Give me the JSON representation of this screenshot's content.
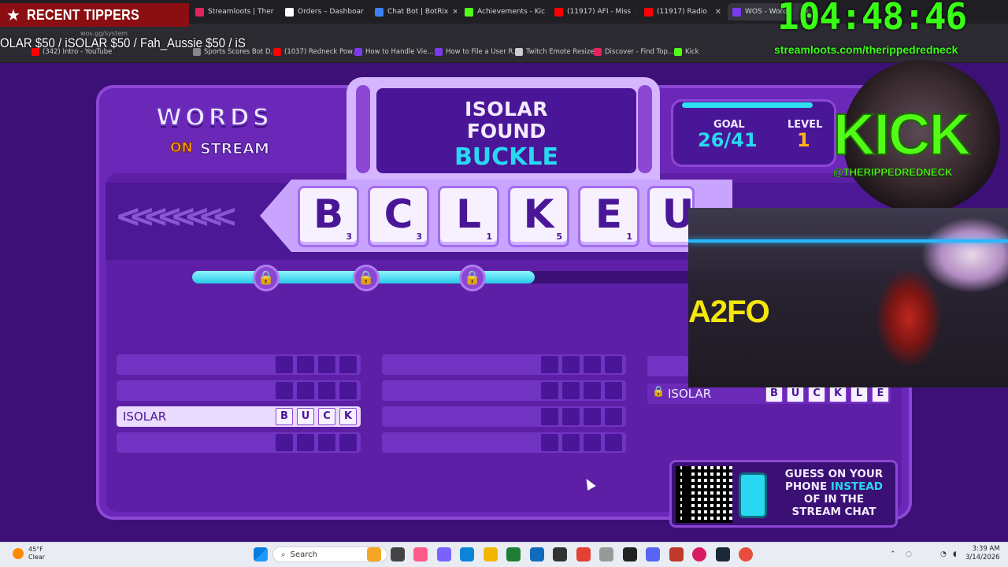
{
  "browser": {
    "tabs": [
      {
        "label": "Streamloots | Ther",
        "color": "#e0245e"
      },
      {
        "label": "Orders – Dashboar",
        "color": "#ffffff"
      },
      {
        "label": "Chat Bot | BotRix",
        "color": "#3b82f6"
      },
      {
        "label": "Achievements - Kic",
        "color": "#53fc18"
      },
      {
        "label": "(11917) AFI - Miss",
        "color": "#ff0000"
      },
      {
        "label": "(11917) Radio",
        "color": "#ff0000"
      },
      {
        "label": "WOS - Words",
        "color": "#7c3aed"
      }
    ],
    "url": "wos.gg/system",
    "bookmarks": [
      {
        "label": "(342) Intro - YouTube",
        "color": "#ff0000"
      },
      {
        "label": "Sports Scores Bot D...",
        "color": "#888888"
      },
      {
        "label": "(1037) Redneck Pow...",
        "color": "#ff0000"
      },
      {
        "label": "How to Handle Vie...",
        "color": "#7c3aed"
      },
      {
        "label": "How to File a User R...",
        "color": "#7c3aed"
      },
      {
        "label": "Twitch Emote Resizer",
        "color": "#cccccc"
      },
      {
        "label": "Discover - Find Top...",
        "color": "#e0245e"
      },
      {
        "label": "Kick",
        "color": "#53fc18"
      }
    ]
  },
  "overlay": {
    "tippers_title": "RECENT TIPPERS",
    "ticker": "OLAR $50 / iSOLAR $50 / Fah_Aussie $50 /      iS",
    "timer": "104:48:46",
    "streamloots_url": "streamloots.com/therippedredneck",
    "kick_logo": "KICK",
    "kick_handle": "@THERIPPEDREDNECK",
    "webcam_sign": "A2FO"
  },
  "game": {
    "logo_top": "WORDS",
    "logo_on": "ON",
    "logo_stream": "STREAM",
    "found_player": "ISOLAR",
    "found_label": "FOUND",
    "found_word": "BUCKLE",
    "goal_label": "GOAL",
    "goal_value": "26/41",
    "level_label": "LEVEL",
    "level_value": "1",
    "tiles": [
      {
        "letter": "B",
        "score": "3"
      },
      {
        "letter": "C",
        "score": "3"
      },
      {
        "letter": "L",
        "score": "1"
      },
      {
        "letter": "K",
        "score": "5"
      },
      {
        "letter": "E",
        "score": "1"
      },
      {
        "letter": "U",
        "score": ""
      }
    ],
    "progress_fraction": 0.68,
    "word_rows": {
      "col1": [
        {
          "player": "",
          "letters": [
            "",
            "",
            "",
            ""
          ]
        },
        {
          "player": "",
          "letters": [
            "",
            "",
            "",
            ""
          ]
        },
        {
          "player": "ISOLAR",
          "letters": [
            "B",
            "U",
            "C",
            "K"
          ]
        },
        {
          "player": "",
          "letters": [
            "",
            "",
            "",
            ""
          ]
        }
      ],
      "col2": [
        {
          "player": "",
          "letters": [
            "",
            "",
            "",
            ""
          ]
        },
        {
          "player": "",
          "letters": [
            "",
            "",
            "",
            ""
          ]
        },
        {
          "player": "",
          "letters": [
            "",
            "",
            "",
            ""
          ]
        },
        {
          "player": "",
          "letters": [
            "",
            "",
            "",
            ""
          ]
        }
      ],
      "col3_locked": {
        "player": "ISOLAR",
        "letters": [
          "B",
          "U",
          "C",
          "K",
          "L",
          "E"
        ]
      }
    },
    "qr_prompt": {
      "line1": "GUESS ON YOUR",
      "line2a": "PHONE ",
      "line2b": "INSTEAD",
      "line3": "OF IN THE",
      "line4": "STREAM CHAT"
    }
  },
  "taskbar": {
    "weather_temp": "45°F",
    "weather_cond": "Clear",
    "search_label": "Search",
    "time": "3:39 AM",
    "date": "3/14/2026"
  },
  "colors": {
    "background": "#3d1078",
    "accent_cyan": "#29d8f0",
    "kick_green": "#53fc18",
    "timer_green": "#39ff14",
    "tippers_red": "#8b0f12"
  }
}
